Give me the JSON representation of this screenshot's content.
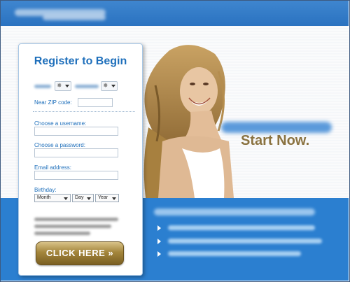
{
  "form": {
    "title": "Register to Begin",
    "zip_label": "Near ZIP code:",
    "username_label": "Choose a username:",
    "password_label": "Choose a password:",
    "email_label": "Email address:",
    "birthday_label": "Birthday:",
    "birthday_month": "Month",
    "birthday_day": "Day",
    "birthday_year": "Year",
    "cta_label": "CLICK HERE »"
  },
  "promo": {
    "tagline": "Start Now."
  },
  "colors": {
    "accent_blue": "#1e6fbb",
    "band_blue": "#2b7fd0",
    "cta_gold": "#a4863c",
    "tagline_gold": "#8a7240"
  }
}
